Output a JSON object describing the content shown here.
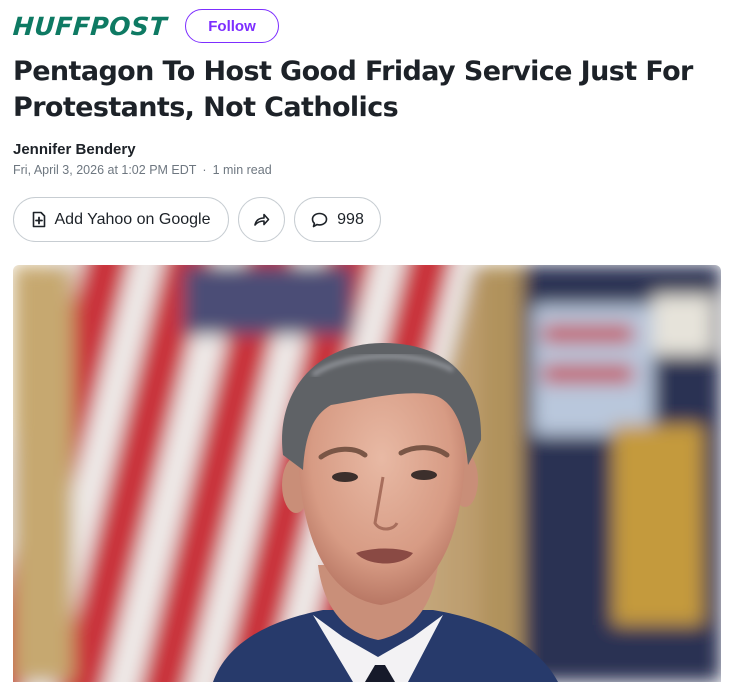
{
  "publisher": {
    "name": "HUFFPOST",
    "follow_label": "Follow"
  },
  "article": {
    "headline": "Pentagon To Host Good Friday Service Just For Protestants, Not Catholics",
    "author": "Jennifer Bendery",
    "date": "Fri, April 3, 2026 at 1:02 PM EDT",
    "separator": "·",
    "read_time": "1 min read"
  },
  "actions": {
    "add_source_label": "Add Yahoo on Google",
    "add_source_icon": "add-document-icon",
    "share_icon": "share-arrow-icon",
    "comments_icon": "speech-bubble-icon",
    "comment_count": "998"
  },
  "colors": {
    "brand": "#0e7a63",
    "accent": "#7d2eff",
    "text": "#1d2228",
    "muted": "#6e7780"
  }
}
